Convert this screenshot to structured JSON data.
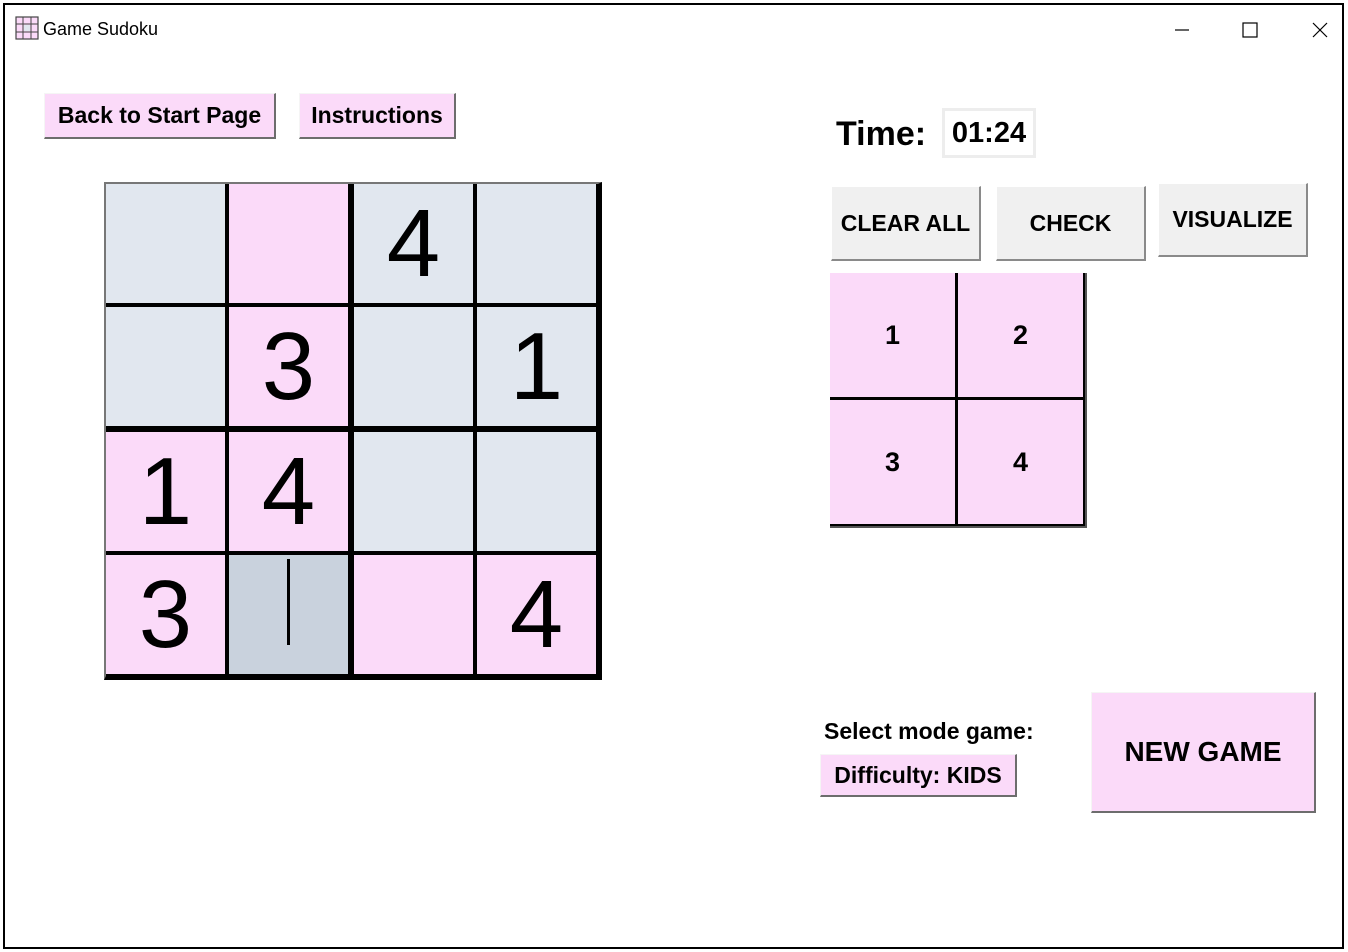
{
  "window": {
    "title": "Game Sudoku",
    "app_icon": "sudoku-grid-icon"
  },
  "toolbar": {
    "back_label": "Back to Start Page",
    "instructions_label": "Instructions"
  },
  "board": {
    "size": 4,
    "cells": [
      [
        {
          "value": "",
          "shade": "blue"
        },
        {
          "value": "",
          "shade": "pink"
        },
        {
          "value": "4",
          "shade": "blue"
        },
        {
          "value": "",
          "shade": "blue"
        }
      ],
      [
        {
          "value": "",
          "shade": "blue"
        },
        {
          "value": "3",
          "shade": "pink"
        },
        {
          "value": "",
          "shade": "blue"
        },
        {
          "value": "1",
          "shade": "blue"
        }
      ],
      [
        {
          "value": "1",
          "shade": "pink"
        },
        {
          "value": "4",
          "shade": "pink"
        },
        {
          "value": "",
          "shade": "blue"
        },
        {
          "value": "",
          "shade": "blue"
        }
      ],
      [
        {
          "value": "3",
          "shade": "pink"
        },
        {
          "value": "",
          "shade": "selected"
        },
        {
          "value": "",
          "shade": "pink"
        },
        {
          "value": "4",
          "shade": "pink"
        }
      ]
    ],
    "selected_cell": {
      "row": 3,
      "col": 1
    }
  },
  "timer": {
    "label": "Time:",
    "value": "01:24"
  },
  "actions": {
    "clear_all": "CLEAR ALL",
    "check": "CHECK",
    "visualize": "VISUALIZE"
  },
  "numpad": {
    "keys": [
      "1",
      "2",
      "3",
      "4"
    ]
  },
  "mode": {
    "label": "Select mode game:",
    "difficulty": "Difficulty: KIDS"
  },
  "new_game_label": "NEW GAME",
  "colors": {
    "pink": "#fbdaf9",
    "blue": "#e1e7ef",
    "selected": "#c9d2dd",
    "button_gray": "#f0f0f0"
  }
}
